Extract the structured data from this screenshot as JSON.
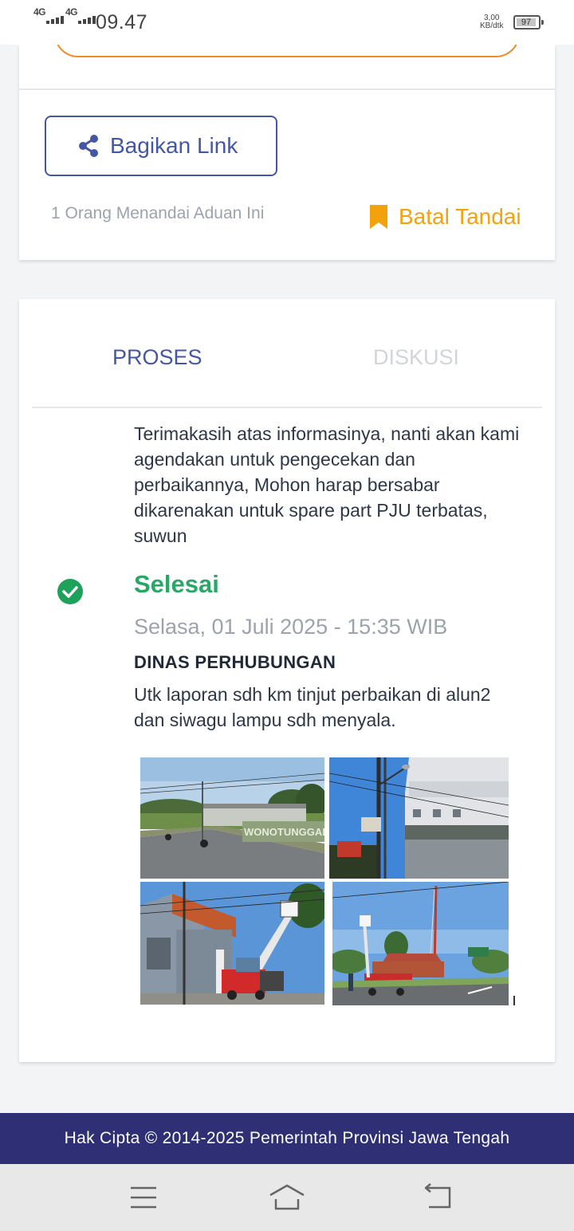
{
  "status_bar": {
    "net1": "4G",
    "net2": "4G",
    "time": "09.47",
    "speed_value": "3,00",
    "speed_unit": "KB/dtk",
    "battery": "97"
  },
  "share": {
    "label": "Bagikan Link",
    "icon": "share-icon"
  },
  "bookmark": {
    "count_text": "1 Orang Menandai Aduan Ini",
    "unmark_label": "Batal Tandai",
    "icon": "bookmark-icon",
    "color": "#f2a20c"
  },
  "tabs": [
    {
      "label": "PROSES",
      "active": true
    },
    {
      "label": "DISKUSI",
      "active": false
    }
  ],
  "process": {
    "previous_message": "Terimakasih atas informasinya, nanti akan kami agendakan untuk pengecekan dan perbaikannya, Mohon harap bersabar dikarenakan untuk spare part PJU terbatas, suwun",
    "status": "Selesai",
    "status_color": "#27a864",
    "date": "Selasa, 01 Juli 2025 - 15:35 WIB",
    "agency": "DINAS PERHUBUNGAN",
    "note": "Utk laporan sdh km tinjut perbaikan di alun2 dan siwagu lampu sdh menyala.",
    "photos": [
      {
        "sign_text": "WONOTUNGGAL"
      },
      {},
      {},
      {}
    ]
  },
  "footer": {
    "copyright": "Hak Cipta © 2014-2025 Pemerintah Provinsi Jawa Tengah",
    "bg": "#2e2f74"
  },
  "nav": [
    "menu-icon",
    "home-icon",
    "back-icon"
  ]
}
